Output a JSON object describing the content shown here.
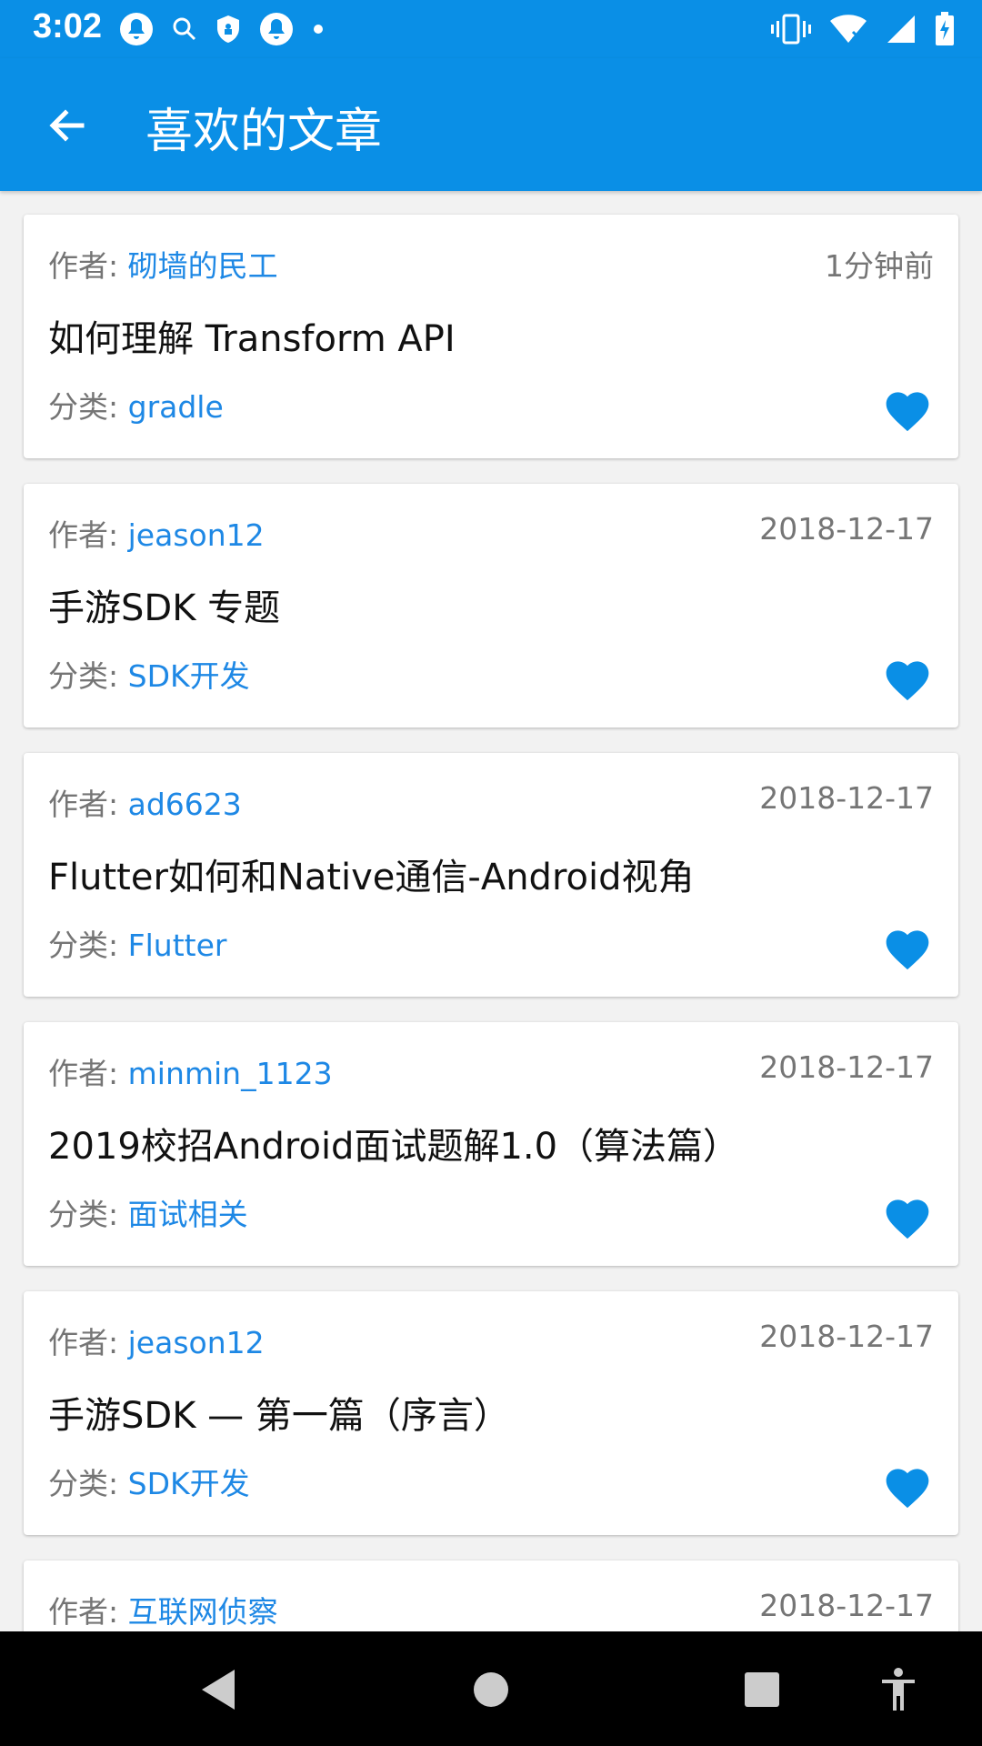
{
  "status_bar": {
    "time": "3:02",
    "left_icons": [
      "notification-bell-icon",
      "search-icon",
      "shield-icon",
      "notification-bell-icon",
      "dot-icon"
    ],
    "right_icons": [
      "vibrate-icon",
      "wifi-icon",
      "signal-icon",
      "battery-charging-icon"
    ]
  },
  "app_bar": {
    "back_icon": "arrow-left-icon",
    "title": "喜欢的文章",
    "color": "#0a8fe6"
  },
  "labels": {
    "author_prefix": "作者:",
    "category_prefix": "分类:"
  },
  "articles": [
    {
      "author": "砌墙的民工",
      "time": "1分钟前",
      "title": "如何理解 Transform API",
      "category": "gradle",
      "liked": true
    },
    {
      "author": "jeason12",
      "time": "2018-12-17",
      "title": "手游SDK 专题",
      "category": "SDK开发",
      "liked": true
    },
    {
      "author": "ad6623",
      "time": "2018-12-17",
      "title": "Flutter如何和Native通信-Android视角",
      "category": "Flutter",
      "liked": true
    },
    {
      "author": "minmin_1123",
      "time": "2018-12-17",
      "title": "2019校招Android面试题解1.0（算法篇）",
      "category": "面试相关",
      "liked": true
    },
    {
      "author": "jeason12",
      "time": "2018-12-17",
      "title": "手游SDK — 第一篇（序言）",
      "category": "SDK开发",
      "liked": true
    },
    {
      "author": "互联网侦察",
      "time": "2018-12-17",
      "title": "",
      "category": "",
      "liked": true
    }
  ],
  "nav_bar": {
    "buttons": [
      "back-triangle-icon",
      "home-circle-icon",
      "recents-square-icon",
      "accessibility-icon"
    ]
  },
  "colors": {
    "accent": "#1e88e5",
    "heart": "#0a8fe6",
    "secondary_text": "#757575"
  }
}
